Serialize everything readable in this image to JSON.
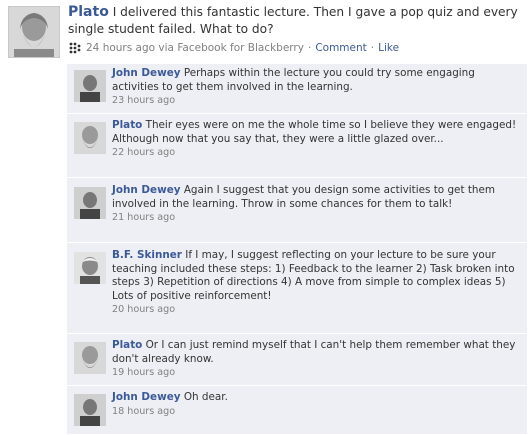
{
  "post": {
    "author": "Plato",
    "text": "I delivered this fantastic lecture. Then I gave a pop quiz and every single student failed. What to do?",
    "timestamp": "24 hours ago via Facebook for Blackberry",
    "separator": "·",
    "comment_link": "Comment",
    "like_link": "Like",
    "icon": "blackberry-icon"
  },
  "comments": [
    {
      "author": "John Dewey",
      "text": "Perhaps within the lecture you could try some engaging activities to get them involved in the learning.",
      "time": "23 hours ago",
      "avatar": "dewey"
    },
    {
      "author": "Plato",
      "text": "Their eyes were on me the whole time so I believe they were engaged! Although now that you say that, they were a little glazed over...",
      "time": "22 hours ago",
      "avatar": "plato"
    },
    {
      "author": "John Dewey",
      "text": "Again I suggest that you design some activities to get them involved in the learning. Throw in some chances for them to talk!",
      "time": "21 hours ago",
      "avatar": "dewey"
    },
    {
      "author": "B.F. Skinner",
      "text": "If I may, I suggest reflecting on your lecture to be sure your teaching included these steps: 1) Feedback to the learner 2) Task broken into steps 3) Repetition of directions 4) A move from simple to complex ideas 5) Lots of positive reinforcement!",
      "time": "20 hours ago",
      "avatar": "skinner"
    },
    {
      "author": "Plato",
      "text": "Or I can just remind myself that I can't help them remember what they don't already know.",
      "time": "19 hours ago",
      "avatar": "plato"
    },
    {
      "author": "John Dewey",
      "text": "Oh dear.",
      "time": "18 hours ago",
      "avatar": "dewey"
    }
  ],
  "colors": {
    "link": "#3b5998",
    "comment_bg": "#edeff4",
    "muted": "#808080"
  }
}
